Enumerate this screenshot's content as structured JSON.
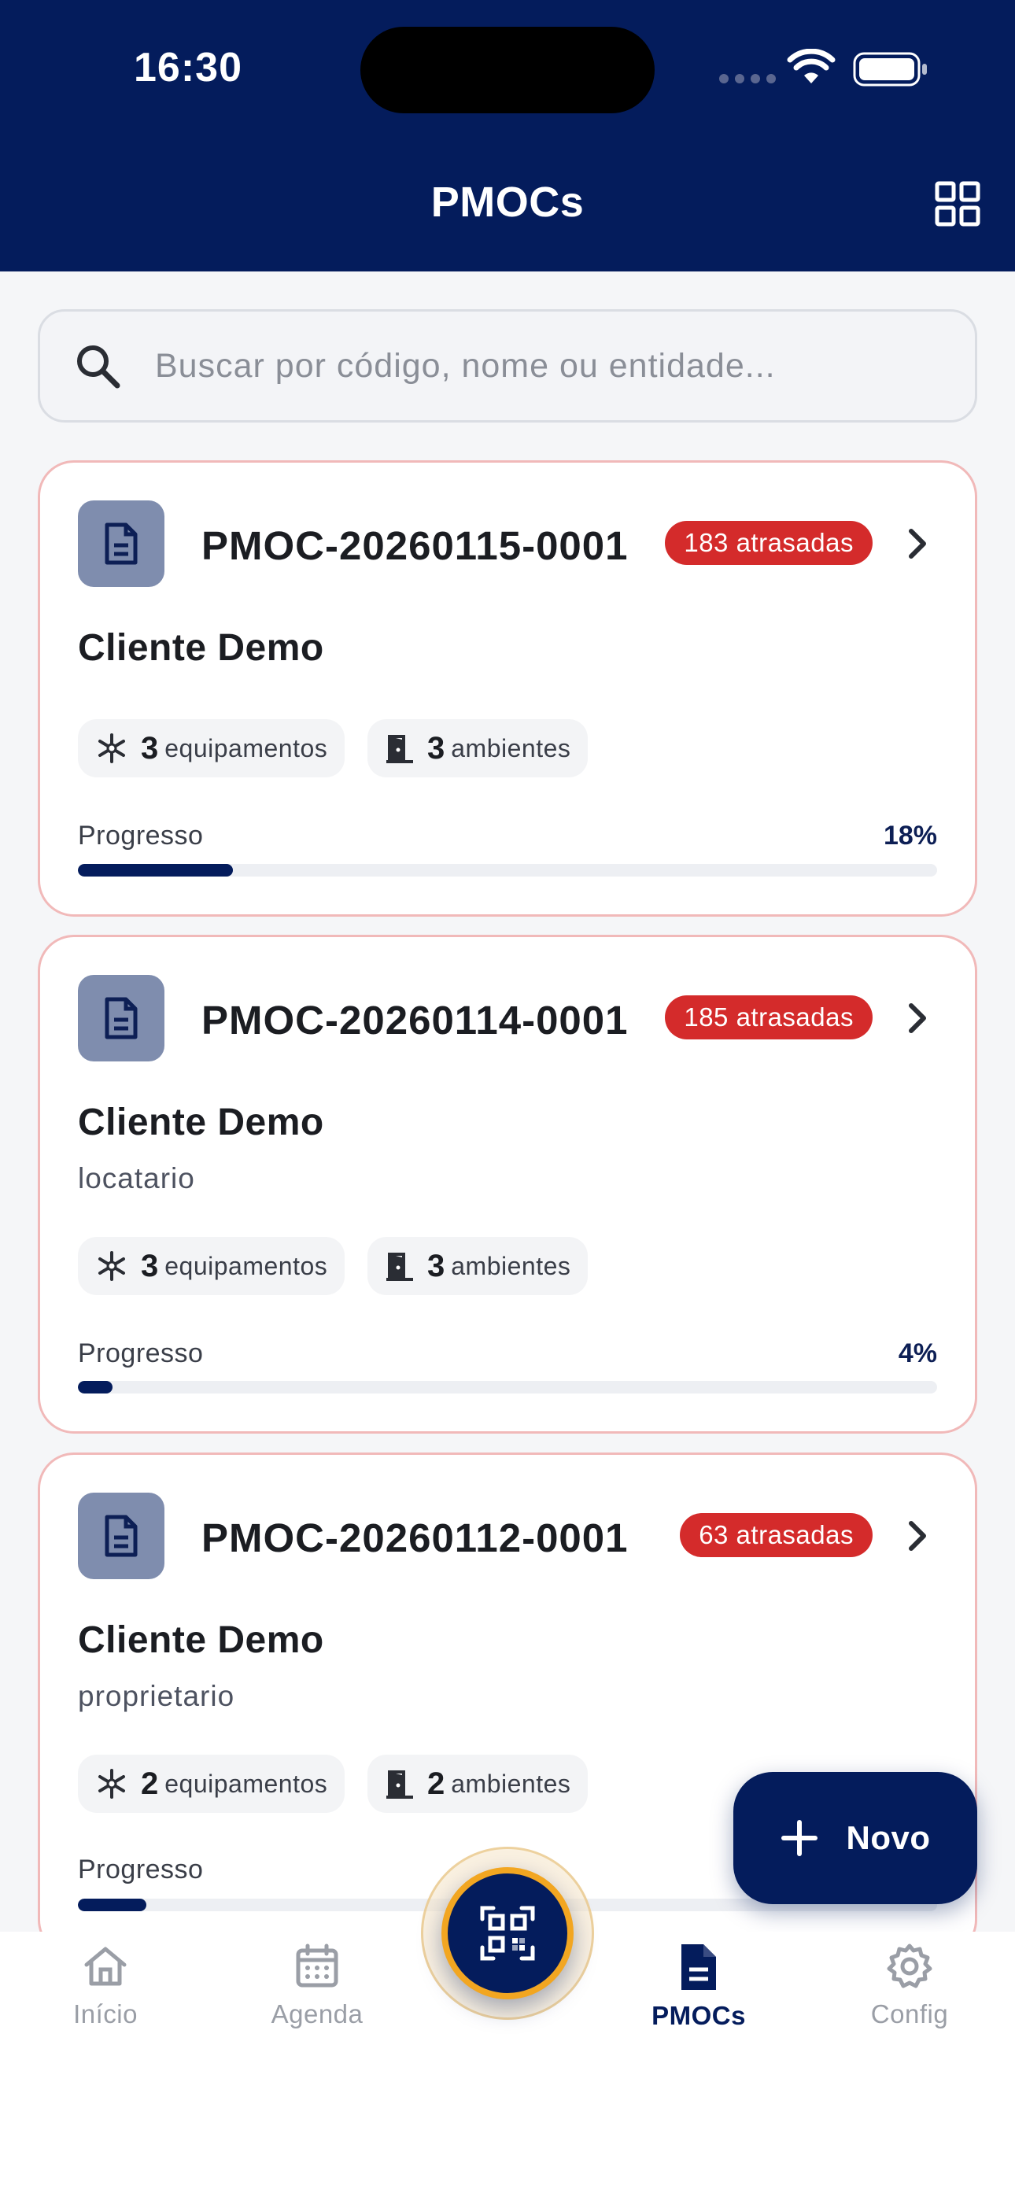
{
  "status_bar": {
    "time": "16:30"
  },
  "header": {
    "title": "PMOCs"
  },
  "search": {
    "placeholder": "Buscar por código, nome ou entidade..."
  },
  "pmocs": [
    {
      "code": "PMOC-20260115-0001",
      "overdue_badge": "183 atrasadas",
      "client": "Cliente Demo",
      "role": "",
      "equipment_count": "3",
      "equipment_label": "equipamentos",
      "room_count": "3",
      "room_label": "ambientes",
      "progress_label": "Progresso",
      "progress_text": "18%",
      "progress": 0.18
    },
    {
      "code": "PMOC-20260114-0001",
      "overdue_badge": "185 atrasadas",
      "client": "Cliente Demo",
      "role": "locatario",
      "equipment_count": "3",
      "equipment_label": "equipamentos",
      "room_count": "3",
      "room_label": "ambientes",
      "progress_label": "Progresso",
      "progress_text": "4%",
      "progress": 0.04
    },
    {
      "code": "PMOC-20260112-0001",
      "overdue_badge": "63 atrasadas",
      "client": "Cliente Demo",
      "role": "proprietario",
      "equipment_count": "2",
      "equipment_label": "equipamentos",
      "room_count": "2",
      "room_label": "ambientes",
      "progress_label": "Progresso",
      "progress": 0.08
    }
  ],
  "fab": {
    "label": "Novo"
  },
  "bottom_nav": {
    "items": [
      {
        "label": "Início",
        "icon": "home-icon"
      },
      {
        "label": "Agenda",
        "icon": "calendar-icon"
      },
      {
        "label": "PMOCs",
        "icon": "document-icon",
        "active": true
      },
      {
        "label": "Config",
        "icon": "gear-icon"
      }
    ],
    "center_action_icon": "qr-scan-icon"
  },
  "colors": {
    "primary": "#041C5C",
    "danger": "#D42B2B",
    "accent": "#F2A621",
    "card_border": "#F1B9B9"
  }
}
